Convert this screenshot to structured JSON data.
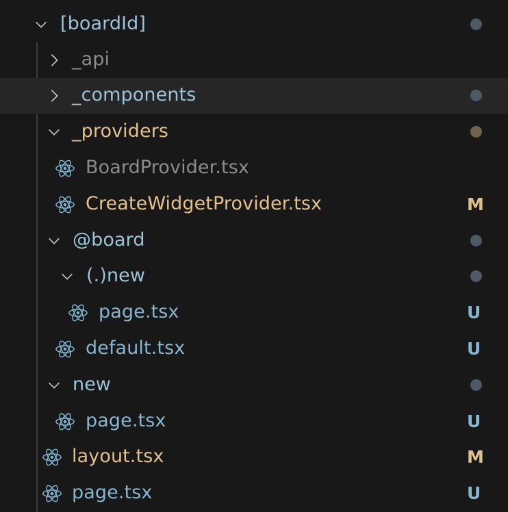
{
  "colors": {
    "background": "#181818",
    "hover_row": "#262626",
    "folder_text": "#9cc4d8",
    "modified_text": "#e2c08d",
    "ignored_text": "#8c8c8c",
    "untracked_text": "#86b6cf",
    "dot_default": "#4b5a64",
    "dot_modified": "#6f6349",
    "react_icon": "#7fb5d0",
    "chevron": "#c5c5c5"
  },
  "tree": [
    {
      "label": "[boardId]",
      "kind": "folder",
      "expanded": true,
      "icon": "chevron-down-icon",
      "status": "dot"
    },
    {
      "label": "_api",
      "kind": "folder",
      "expanded": false,
      "icon": "chevron-right-icon",
      "status": "",
      "ignored": true
    },
    {
      "label": "_components",
      "kind": "folder",
      "expanded": false,
      "icon": "chevron-right-icon",
      "status": "dot",
      "hovered": true
    },
    {
      "label": "_providers",
      "kind": "folder",
      "expanded": true,
      "icon": "chevron-down-icon",
      "status": "dot-modified"
    },
    {
      "label": "BoardProvider.tsx",
      "kind": "file",
      "icon": "react-icon",
      "status": "",
      "ignored": true
    },
    {
      "label": "CreateWidgetProvider.tsx",
      "kind": "file",
      "icon": "react-icon",
      "status": "M"
    },
    {
      "label": "@board",
      "kind": "folder",
      "expanded": true,
      "icon": "chevron-down-icon",
      "status": "dot"
    },
    {
      "label": "(.)new",
      "kind": "folder",
      "expanded": true,
      "icon": "chevron-down-icon",
      "status": "dot"
    },
    {
      "label": "page.tsx",
      "kind": "file",
      "icon": "react-icon",
      "status": "U"
    },
    {
      "label": "default.tsx",
      "kind": "file",
      "icon": "react-icon",
      "status": "U"
    },
    {
      "label": "new",
      "kind": "folder",
      "expanded": true,
      "icon": "chevron-down-icon",
      "status": "dot"
    },
    {
      "label": "page.tsx",
      "kind": "file",
      "icon": "react-icon",
      "status": "U"
    },
    {
      "label": "layout.tsx",
      "kind": "file",
      "icon": "react-icon",
      "status": "M"
    },
    {
      "label": "page.tsx",
      "kind": "file",
      "icon": "react-icon",
      "status": "U"
    }
  ]
}
